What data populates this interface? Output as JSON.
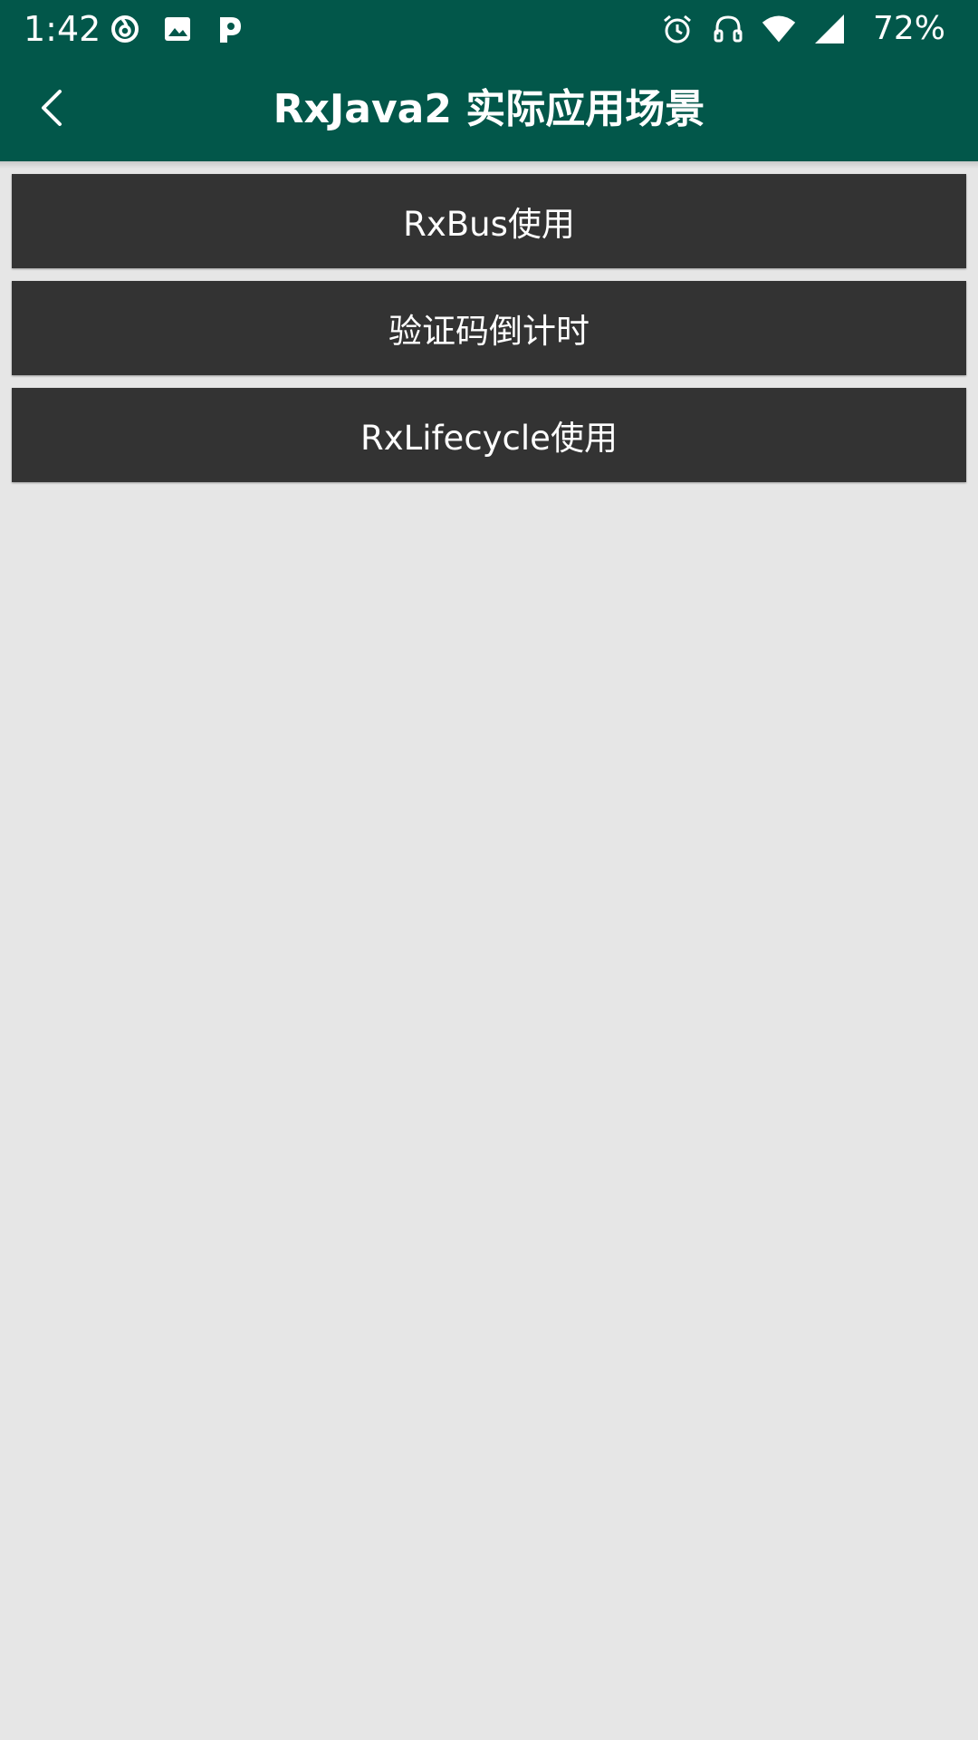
{
  "status_bar": {
    "time": "1:42",
    "battery": "72%",
    "left_icons": [
      "netease-music-icon",
      "image-icon",
      "p-app-icon"
    ],
    "right_icons": [
      "alarm-icon",
      "headset-icon",
      "wifi-icon",
      "signal-icon"
    ]
  },
  "app_bar": {
    "title": "RxJava2 实际应用场景",
    "back_icon": "chevron-left-icon"
  },
  "buttons": [
    {
      "label": "RxBus使用"
    },
    {
      "label": "验证码倒计时"
    },
    {
      "label": "RxLifecycle使用"
    }
  ],
  "colors": {
    "primary": "#02574a",
    "button_bg": "#333333",
    "page_bg": "#e6e6e6",
    "text_on_primary": "#ffffff"
  }
}
